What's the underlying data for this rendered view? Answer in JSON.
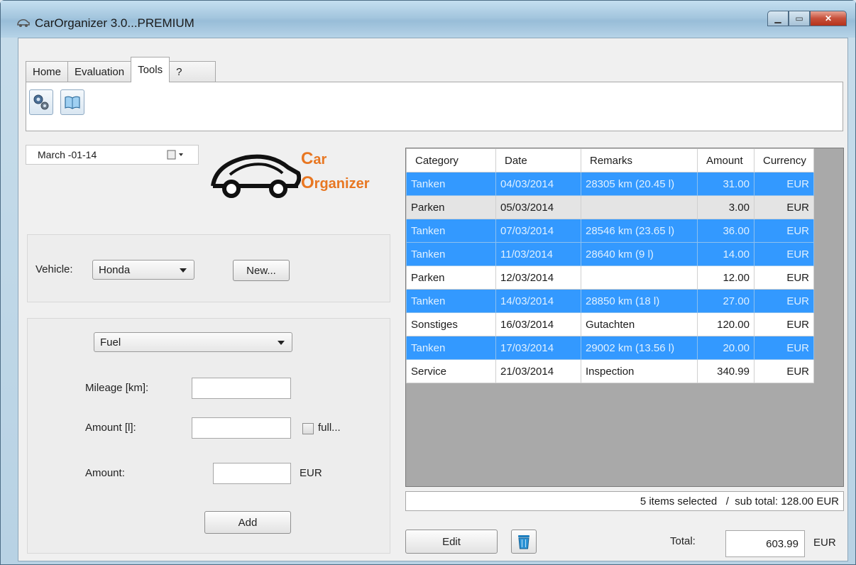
{
  "window": {
    "title": "CarOrganizer 3.0...PREMIUM"
  },
  "tabs": [
    {
      "label": "Home"
    },
    {
      "label": "Evaluation"
    },
    {
      "label": "Tools"
    },
    {
      "label": "?"
    }
  ],
  "toolbar": {
    "icons": [
      "settings-gears-icon",
      "book-icon"
    ]
  },
  "date_picker": {
    "value": "March  -01-14"
  },
  "logo": {
    "word1_initial": "C",
    "word1_rest": "ar",
    "word2_initial": "O",
    "word2_rest": "rganizer"
  },
  "vehicle": {
    "label": "Vehicle:",
    "selected": "Honda",
    "new_button": "New..."
  },
  "entry": {
    "category_selected": "Fuel",
    "mileage_label": "Mileage [km]:",
    "amount_l_label": "Amount [l]:",
    "full_label": "full...",
    "amount_label": "Amount:",
    "currency": "EUR",
    "add_button": "Add"
  },
  "grid": {
    "columns": [
      "Category",
      "Date",
      "Remarks",
      "Amount",
      "Currency"
    ],
    "rows": [
      {
        "category": "Tanken",
        "date": "04/03/2014",
        "remarks": "28305 km (20.45 l)",
        "amount": "31.00",
        "currency": "EUR",
        "selected": true
      },
      {
        "category": "Parken",
        "date": "05/03/2014",
        "remarks": "",
        "amount": "3.00",
        "currency": "EUR",
        "selected": false
      },
      {
        "category": "Tanken",
        "date": "07/03/2014",
        "remarks": "28546 km (23.65 l)",
        "amount": "36.00",
        "currency": "EUR",
        "selected": true
      },
      {
        "category": "Tanken",
        "date": "11/03/2014",
        "remarks": "28640 km (9 l)",
        "amount": "14.00",
        "currency": "EUR",
        "selected": true
      },
      {
        "category": "Parken",
        "date": "12/03/2014",
        "remarks": "",
        "amount": "12.00",
        "currency": "EUR",
        "selected": false
      },
      {
        "category": "Tanken",
        "date": "14/03/2014",
        "remarks": "28850 km (18 l)",
        "amount": "27.00",
        "currency": "EUR",
        "selected": true
      },
      {
        "category": "Sonstiges",
        "date": "16/03/2014",
        "remarks": "Gutachten",
        "amount": "120.00",
        "currency": "EUR",
        "selected": false
      },
      {
        "category": "Tanken",
        "date": "17/03/2014",
        "remarks": "29002 km (13.56 l)",
        "amount": "20.00",
        "currency": "EUR",
        "selected": true
      },
      {
        "category": "Service",
        "date": "21/03/2014",
        "remarks": "Inspection",
        "amount": "340.99",
        "currency": "EUR",
        "selected": false
      }
    ]
  },
  "status": {
    "selection_text": "5 items selected   /  sub total: 128.00 EUR"
  },
  "footer": {
    "edit_button": "Edit",
    "total_label": "Total:",
    "total_value": "603.99",
    "total_currency": "EUR"
  },
  "colors": {
    "selection": "#3399ff",
    "logo_orange": "#e87722"
  }
}
